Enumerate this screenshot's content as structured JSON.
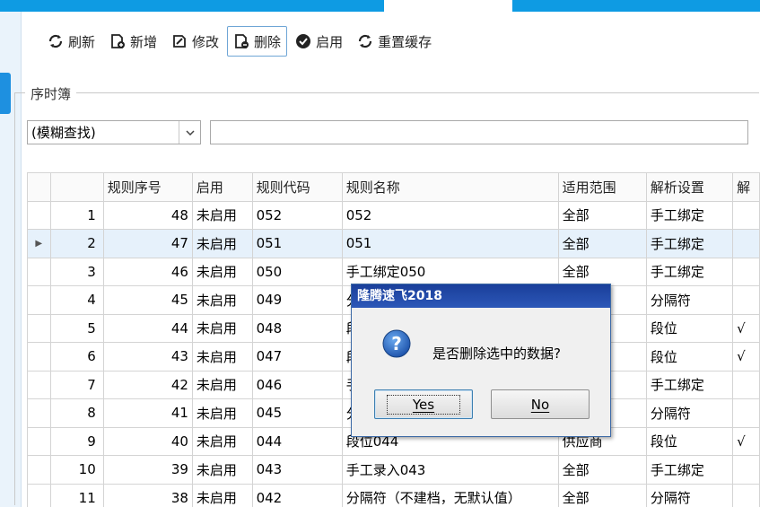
{
  "colors": {
    "accent": "#0e9be3",
    "dialog_title": "#1a3f9a",
    "selected_row": "#e6f1fb"
  },
  "toolbar": {
    "buttons": [
      {
        "label": "刷新",
        "icon": "refresh-icon"
      },
      {
        "label": "新增",
        "icon": "add-doc-icon"
      },
      {
        "label": "修改",
        "icon": "edit-icon"
      },
      {
        "label": "删除",
        "icon": "delete-doc-icon"
      },
      {
        "label": "启用",
        "icon": "check-circle-icon"
      },
      {
        "label": "重置缓存",
        "icon": "refresh-icon"
      }
    ]
  },
  "group": {
    "label": "序时簿"
  },
  "filter": {
    "mode": "(模糊查找)",
    "query": ""
  },
  "table": {
    "columns": [
      "规则序号",
      "启用",
      "规则代码",
      "规则名称",
      "适用范围",
      "解析设置",
      "解"
    ],
    "selected_row": 2,
    "rows": [
      {
        "no": "1",
        "seq": "48",
        "enabled": "未启用",
        "code": "052",
        "name": "052",
        "scope": "全部",
        "parse": "手工绑定",
        "extra": ""
      },
      {
        "no": "2",
        "seq": "47",
        "enabled": "未启用",
        "code": "051",
        "name": "051",
        "scope": "全部",
        "parse": "手工绑定",
        "extra": ""
      },
      {
        "no": "3",
        "seq": "46",
        "enabled": "未启用",
        "code": "050",
        "name": "手工绑定050",
        "scope": "全部",
        "parse": "手工绑定",
        "extra": ""
      },
      {
        "no": "4",
        "seq": "45",
        "enabled": "未启用",
        "code": "049",
        "name": "分",
        "scope": "",
        "parse": "分隔符",
        "extra": ""
      },
      {
        "no": "5",
        "seq": "44",
        "enabled": "未启用",
        "code": "048",
        "name": "段",
        "scope": "",
        "parse": "段位",
        "extra": "√"
      },
      {
        "no": "6",
        "seq": "43",
        "enabled": "未启用",
        "code": "047",
        "name": "段",
        "scope": "",
        "parse": "段位",
        "extra": "√"
      },
      {
        "no": "7",
        "seq": "42",
        "enabled": "未启用",
        "code": "046",
        "name": "手",
        "scope": "",
        "parse": "手工绑定",
        "extra": ""
      },
      {
        "no": "8",
        "seq": "41",
        "enabled": "未启用",
        "code": "045",
        "name": "分",
        "scope": "",
        "parse": "分隔符",
        "extra": ""
      },
      {
        "no": "9",
        "seq": "40",
        "enabled": "未启用",
        "code": "044",
        "name": "段位044",
        "scope": "供应商",
        "parse": "段位",
        "extra": "√"
      },
      {
        "no": "10",
        "seq": "39",
        "enabled": "未启用",
        "code": "043",
        "name": "手工录入043",
        "scope": "全部",
        "parse": "手工绑定",
        "extra": ""
      },
      {
        "no": "11",
        "seq": "38",
        "enabled": "未启用",
        "code": "042",
        "name": "分隔符（不建档，无默认值）",
        "scope": "全部",
        "parse": "分隔符",
        "extra": ""
      }
    ]
  },
  "dialog": {
    "title": "隆腾速飞2018",
    "message": "是否删除选中的数据?",
    "icon": "question-icon",
    "yes_label": "Yes",
    "no_label": "No"
  }
}
